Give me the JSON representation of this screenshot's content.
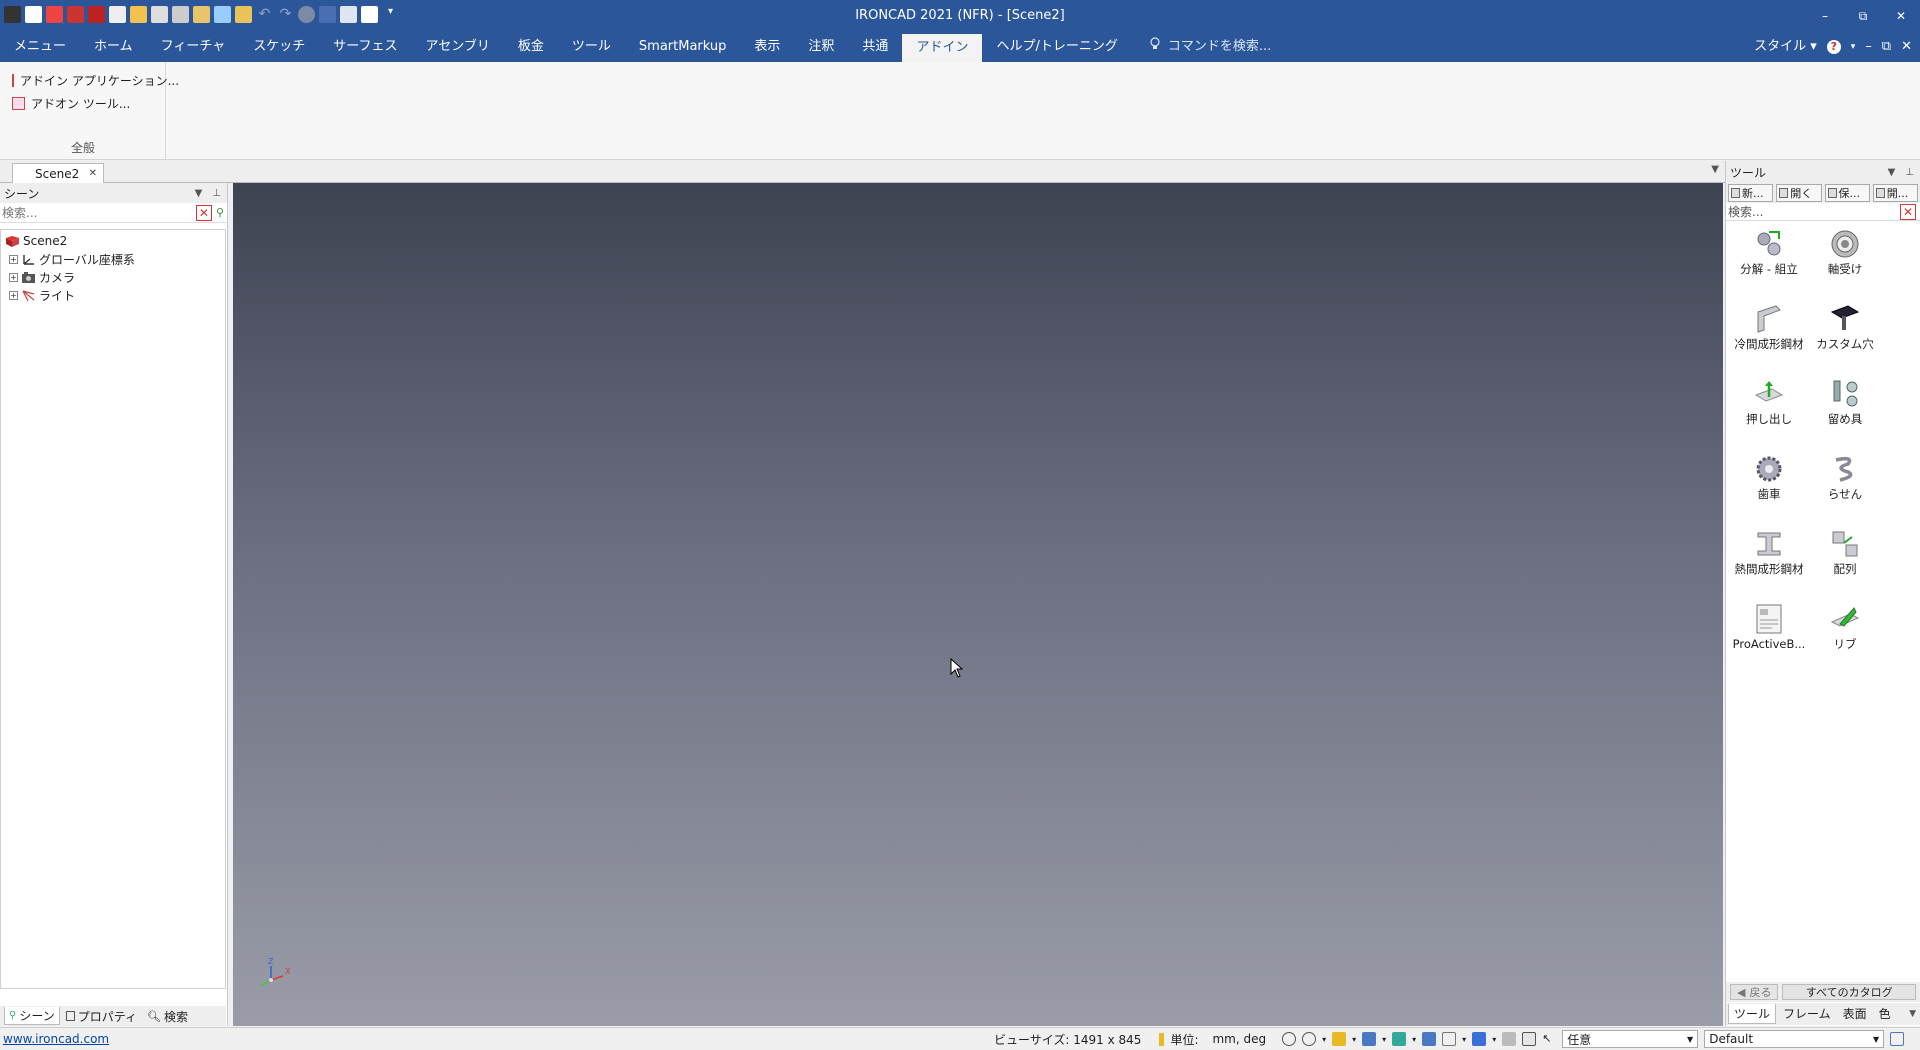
{
  "window": {
    "title": "IRONCAD 2021 (NFR) - [Scene2]",
    "controls": {
      "minimize": "–",
      "restore": "⧉",
      "close": "✕"
    }
  },
  "menu": {
    "tabs": [
      "メニュー",
      "ホーム",
      "フィーチャ",
      "スケッチ",
      "サーフェス",
      "アセンブリ",
      "板金",
      "ツール",
      "SmartMarkup",
      "表示",
      "注釈",
      "共通",
      "アドイン",
      "ヘルプ/トレーニング"
    ],
    "active_tab": "アドイン",
    "command_search": "コマンドを検索...",
    "style_label": "スタイル"
  },
  "ribbon": {
    "items": [
      "アドイン アプリケーション...",
      "アドオン ツール..."
    ],
    "group_label": "全般"
  },
  "document": {
    "tab_label": "Scene2"
  },
  "scene_panel": {
    "title": "シーン",
    "search_placeholder": "検索...",
    "tree": {
      "root": "Scene2",
      "children": [
        "グローバル座標系",
        "カメラ",
        "ライト"
      ]
    },
    "bottom_tabs": [
      "シーン",
      "プロパティ",
      "検索"
    ]
  },
  "viewport": {
    "triad": {
      "z": "Z",
      "x": "X"
    }
  },
  "tools_panel": {
    "title": "ツール",
    "toolbar": [
      "新...",
      "開く",
      "保...",
      "開..."
    ],
    "search_placeholder": "検索...",
    "items": [
      "分解 - 組立",
      "軸受け",
      "冷間成形鋼材",
      "カスタム穴",
      "押し出し",
      "留め具",
      "歯車",
      "らせん",
      "熱間成形鋼材",
      "配列",
      "ProActiveB...",
      "リブ"
    ],
    "nav": {
      "back": "戻る",
      "all_catalogs": "すべてのカタログ"
    },
    "bottom_tabs": [
      "ツール",
      "フレーム",
      "表面",
      "色"
    ]
  },
  "statusbar": {
    "link": "www.ironcad.com",
    "view_size": "ビューサイズ: 1491 x  845",
    "units_label": "単位:",
    "units_value": "mm, deg",
    "selection_mode": "任意",
    "style": "Default"
  }
}
